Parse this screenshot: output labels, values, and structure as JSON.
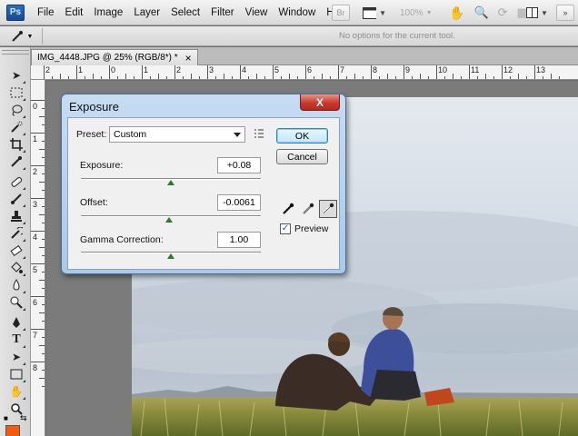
{
  "app": {
    "logo": "Ps"
  },
  "menu": [
    "File",
    "Edit",
    "Image",
    "Layer",
    "Select",
    "Filter",
    "View",
    "Window",
    "Help"
  ],
  "appbar": {
    "br_label": "Br",
    "zoom": "100%"
  },
  "options_bar": {
    "message": "No options for the current tool."
  },
  "document": {
    "tab_title": "IMG_4448.JPG @ 25% (RGB/8*) *",
    "close_glyph": "×"
  },
  "ruler": {
    "h_labels": [
      "2",
      "1",
      "0",
      "1",
      "2",
      "3",
      "4",
      "5",
      "6",
      "7",
      "8",
      "9",
      "10",
      "11",
      "12",
      "13"
    ],
    "v_labels": [
      "0",
      "1",
      "2",
      "3",
      "4",
      "5",
      "6",
      "7",
      "8"
    ]
  },
  "dialog": {
    "title": "Exposure",
    "close_glyph": "X",
    "preset_label": "Preset:",
    "preset_value": "Custom",
    "exposure_label": "Exposure:",
    "exposure_value": "+0.08",
    "exposure_slider": 0.5,
    "offset_label": "Offset:",
    "offset_value": "-0.0061",
    "offset_slider": 0.49,
    "gamma_label": "Gamma Correction:",
    "gamma_value": "1.00",
    "gamma_slider": 0.5,
    "ok_label": "OK",
    "cancel_label": "Cancel",
    "preview_label": "Preview",
    "preview_checked": true,
    "check_glyph": "✓"
  },
  "colors": {
    "foreground": "#f25a0e",
    "accent": "#3c7fb1"
  }
}
